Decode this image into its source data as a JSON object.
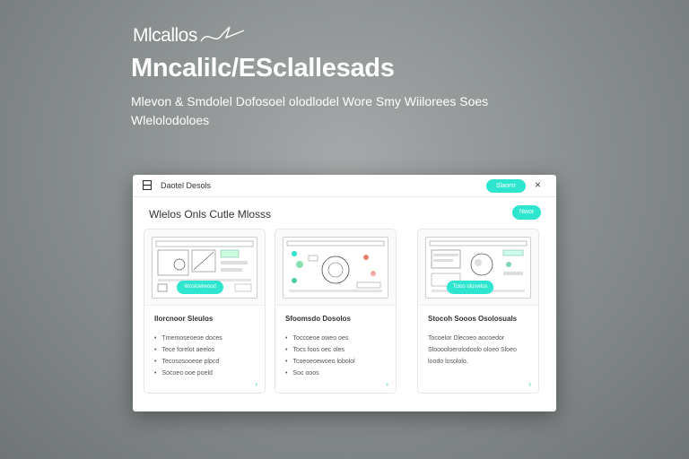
{
  "hero": {
    "brand": "Mlcallos",
    "headline": "Mncalilc/ESclallesads",
    "subtitle": "Mlevon & Smdolel Dofosoel olodlodel Wore Smy Wiilorees Soes Wlelolodoloes"
  },
  "window": {
    "title": "Daotel Desols",
    "top_button": "Slaomr",
    "close": "×",
    "section_title": "Wlelos Onls Cutle Mlosss",
    "new_button": "Nwor"
  },
  "cards": [
    {
      "button": "Wosloelwood",
      "title": "Ilorcnoor Sleulos",
      "bullets": [
        "Tmemoseoeoe doces",
        "Tece forelot aeelos",
        "Tecososooeoe plpcd",
        "Socoeo ooe poeld"
      ],
      "arrow": "›"
    },
    {
      "button": "",
      "title": "Sfoomsdo Dosolos",
      "bullets": [
        "Toccoeoe oweo oes",
        "Tocs foos oec oles",
        "Tcoeoeoewoeo lobolol",
        "Soc ooos"
      ],
      "arrow": "›"
    },
    {
      "button": "Tcloo oloswlos",
      "title": "Stocoh Sooos Osolosuals",
      "paragraph": "Tocoelor Dlecoeo aocoedor Slooooloerolodoolo oloeo Sloeo loodo losololo.",
      "arrow": "›"
    }
  ],
  "colors": {
    "accent": "#2ee6cf"
  }
}
